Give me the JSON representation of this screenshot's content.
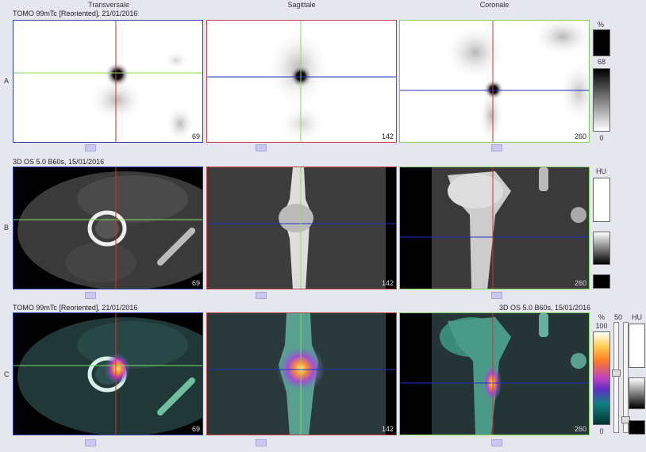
{
  "columns": {
    "transversal": "Transversale",
    "sagittal": "Sagittale",
    "coronal": "Coronale"
  },
  "rows": {
    "a": {
      "letter": "A",
      "title": "TOMO 99mTc [Reoriented], 21/01/2016"
    },
    "b": {
      "letter": "B",
      "title": "3D OS 5.0 B60s, 15/01/2016"
    },
    "c": {
      "letter": "C",
      "title_left": "TOMO 99mTc [Reoriented], 21/01/2016",
      "title_right": "3D OS 5.0 B60s, 15/01/2016"
    }
  },
  "slices": {
    "transversal": "69",
    "sagittal": "142",
    "coronal": "260"
  },
  "scales": {
    "a": {
      "unit": "%",
      "top": "68",
      "bottom": "0"
    },
    "b": {
      "unit": "HU"
    },
    "c": {
      "unit_pct": "%",
      "top": "100",
      "bottom": "0",
      "mid": "50",
      "unit_hu": "HU"
    }
  },
  "colors": {
    "crosshair_red": "#e03020",
    "crosshair_green": "#80e060",
    "crosshair_blue": "#2030c0",
    "border_blue": "#3040a0",
    "border_red": "#c04040",
    "border_green": "#80d060"
  }
}
